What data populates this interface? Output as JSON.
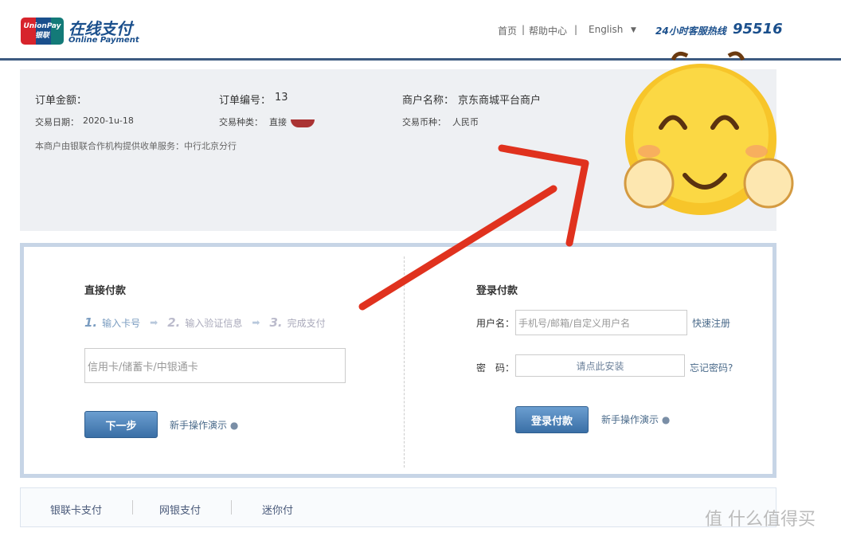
{
  "header": {
    "logo_text": "UnionPay 银联",
    "title": "在线支付",
    "subtitle": "Online Payment",
    "nav": [
      "首页",
      "帮助中心",
      "English"
    ],
    "hotline_label": "24小时客服热线",
    "hotline": "95516",
    "separator": "|"
  },
  "order": {
    "amount_label": "订单金额：",
    "amount_value": "",
    "number_label": "订单编号：",
    "number_value": "13",
    "merchant_label": "商户名称：",
    "merchant_value": "京东商城平台商户",
    "date_label": "交易日期：",
    "date_value": "2020-1u-18",
    "type_label": "交易种类：",
    "type_value": "直接",
    "currency_label": "交易币种：",
    "currency_value": "人民币",
    "acquirer_note": "本商户由银联合作机构提供收单服务：中行北京分行"
  },
  "direct": {
    "title": "直接付款",
    "steps": [
      {
        "n": "1.",
        "label": "输入卡号"
      },
      {
        "n": "2.",
        "label": "输入验证信息"
      },
      {
        "n": "3.",
        "label": "完成支付"
      }
    ],
    "card_placeholder": "信用卡/储蓄卡/中银通卡",
    "next_button": "下一步",
    "demo_link": "新手操作演示"
  },
  "login": {
    "title": "登录付款",
    "username_label": "用户名：",
    "username_placeholder": "手机号/邮箱/自定义用户名",
    "register_link": "快速注册",
    "password_label": "密　码：",
    "password_prompt": "请点此安装",
    "forgot_link": "忘记密码?",
    "login_button": "登录付款",
    "demo_link": "新手操作演示"
  },
  "footer_tabs": [
    "银联卡支付",
    "网银支付",
    "迷你付"
  ],
  "watermark": "值 什么值得买",
  "colors": {
    "brand": "#1a4f8c",
    "annotation_arrow": "#e0321e"
  }
}
